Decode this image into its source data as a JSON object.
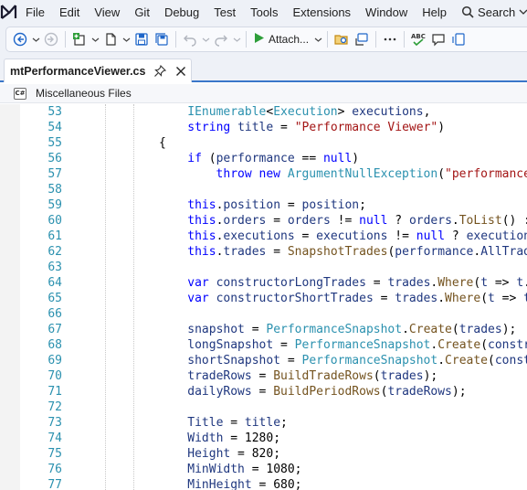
{
  "menubar": {
    "items": [
      "File",
      "Edit",
      "View",
      "Git",
      "Debug",
      "Test",
      "Tools",
      "Extensions",
      "Window",
      "Help"
    ],
    "search_label": "Search"
  },
  "toolbar": {
    "attach_label": "Attach..."
  },
  "tabs": [
    {
      "label": "mtPerformanceViewer.cs"
    }
  ],
  "navbar": {
    "icon_text": "C#",
    "scope_label": "Miscellaneous Files"
  },
  "editor": {
    "lines": [
      {
        "num": "53",
        "indent": 4,
        "tokens": [
          [
            "ty",
            "IEnumerable"
          ],
          [
            "pl",
            "<"
          ],
          [
            "ty",
            "Execution"
          ],
          [
            "pl",
            "> "
          ],
          [
            "id",
            "executions"
          ],
          [
            "pl",
            ","
          ]
        ]
      },
      {
        "num": "54",
        "indent": 4,
        "tokens": [
          [
            "kw",
            "string"
          ],
          [
            "pl",
            " "
          ],
          [
            "id",
            "title"
          ],
          [
            "pl",
            " = "
          ],
          [
            "st",
            "\"Performance Viewer\""
          ],
          [
            "pl",
            ")"
          ]
        ]
      },
      {
        "num": "55",
        "indent": 0,
        "tokens": [
          [
            "pl",
            "{"
          ]
        ]
      },
      {
        "num": "56",
        "indent": 4,
        "tokens": [
          [
            "kw",
            "if"
          ],
          [
            "pl",
            " ("
          ],
          [
            "id",
            "performance"
          ],
          [
            "pl",
            " == "
          ],
          [
            "kw",
            "null"
          ],
          [
            "pl",
            ")"
          ]
        ]
      },
      {
        "num": "57",
        "indent": 8,
        "tokens": [
          [
            "kw",
            "throw"
          ],
          [
            "pl",
            " "
          ],
          [
            "kw",
            "new"
          ],
          [
            "pl",
            " "
          ],
          [
            "ty",
            "ArgumentNullException"
          ],
          [
            "pl",
            "("
          ],
          [
            "st",
            "\"performance\""
          ]
        ]
      },
      {
        "num": "58",
        "indent": 0,
        "tokens": []
      },
      {
        "num": "59",
        "indent": 4,
        "tokens": [
          [
            "kw",
            "this"
          ],
          [
            "pl",
            "."
          ],
          [
            "id",
            "position"
          ],
          [
            "pl",
            " = "
          ],
          [
            "id",
            "position"
          ],
          [
            "pl",
            ";"
          ]
        ]
      },
      {
        "num": "60",
        "indent": 4,
        "tokens": [
          [
            "kw",
            "this"
          ],
          [
            "pl",
            "."
          ],
          [
            "id",
            "orders"
          ],
          [
            "pl",
            " = "
          ],
          [
            "id",
            "orders"
          ],
          [
            "pl",
            " != "
          ],
          [
            "kw",
            "null"
          ],
          [
            "pl",
            " ? "
          ],
          [
            "id",
            "orders"
          ],
          [
            "pl",
            "."
          ],
          [
            "mt",
            "ToList"
          ],
          [
            "pl",
            "() :"
          ]
        ]
      },
      {
        "num": "61",
        "indent": 4,
        "tokens": [
          [
            "kw",
            "this"
          ],
          [
            "pl",
            "."
          ],
          [
            "id",
            "executions"
          ],
          [
            "pl",
            " = "
          ],
          [
            "id",
            "executions"
          ],
          [
            "pl",
            " != "
          ],
          [
            "kw",
            "null"
          ],
          [
            "pl",
            " ? "
          ],
          [
            "id",
            "executions"
          ]
        ]
      },
      {
        "num": "62",
        "indent": 4,
        "tokens": [
          [
            "kw",
            "this"
          ],
          [
            "pl",
            "."
          ],
          [
            "id",
            "trades"
          ],
          [
            "pl",
            " = "
          ],
          [
            "mt",
            "SnapshotTrades"
          ],
          [
            "pl",
            "("
          ],
          [
            "id",
            "performance"
          ],
          [
            "pl",
            "."
          ],
          [
            "id",
            "AllTrades"
          ]
        ]
      },
      {
        "num": "63",
        "indent": 0,
        "tokens": []
      },
      {
        "num": "64",
        "indent": 4,
        "tokens": [
          [
            "kw",
            "var"
          ],
          [
            "pl",
            " "
          ],
          [
            "id",
            "constructorLongTrades"
          ],
          [
            "pl",
            " = "
          ],
          [
            "id",
            "trades"
          ],
          [
            "pl",
            "."
          ],
          [
            "mt",
            "Where"
          ],
          [
            "pl",
            "("
          ],
          [
            "id",
            "t"
          ],
          [
            "pl",
            " => "
          ],
          [
            "id",
            "t"
          ],
          [
            "pl",
            ".E"
          ]
        ]
      },
      {
        "num": "65",
        "indent": 4,
        "tokens": [
          [
            "kw",
            "var"
          ],
          [
            "pl",
            " "
          ],
          [
            "id",
            "constructorShortTrades"
          ],
          [
            "pl",
            " = "
          ],
          [
            "id",
            "trades"
          ],
          [
            "pl",
            "."
          ],
          [
            "mt",
            "Where"
          ],
          [
            "pl",
            "("
          ],
          [
            "id",
            "t"
          ],
          [
            "pl",
            " => "
          ],
          [
            "id",
            "t"
          ],
          [
            "pl",
            "."
          ]
        ]
      },
      {
        "num": "66",
        "indent": 0,
        "tokens": []
      },
      {
        "num": "67",
        "indent": 4,
        "tokens": [
          [
            "id",
            "snapshot"
          ],
          [
            "pl",
            " = "
          ],
          [
            "ty",
            "PerformanceSnapshot"
          ],
          [
            "pl",
            "."
          ],
          [
            "mt",
            "Create"
          ],
          [
            "pl",
            "("
          ],
          [
            "id",
            "trades"
          ],
          [
            "pl",
            ");"
          ]
        ]
      },
      {
        "num": "68",
        "indent": 4,
        "tokens": [
          [
            "id",
            "longSnapshot"
          ],
          [
            "pl",
            " = "
          ],
          [
            "ty",
            "PerformanceSnapshot"
          ],
          [
            "pl",
            "."
          ],
          [
            "mt",
            "Create"
          ],
          [
            "pl",
            "("
          ],
          [
            "id",
            "constru"
          ]
        ]
      },
      {
        "num": "69",
        "indent": 4,
        "tokens": [
          [
            "id",
            "shortSnapshot"
          ],
          [
            "pl",
            " = "
          ],
          [
            "ty",
            "PerformanceSnapshot"
          ],
          [
            "pl",
            "."
          ],
          [
            "mt",
            "Create"
          ],
          [
            "pl",
            "("
          ],
          [
            "id",
            "constr"
          ]
        ]
      },
      {
        "num": "70",
        "indent": 4,
        "tokens": [
          [
            "id",
            "tradeRows"
          ],
          [
            "pl",
            " = "
          ],
          [
            "mt",
            "BuildTradeRows"
          ],
          [
            "pl",
            "("
          ],
          [
            "id",
            "trades"
          ],
          [
            "pl",
            ");"
          ]
        ]
      },
      {
        "num": "71",
        "indent": 4,
        "tokens": [
          [
            "id",
            "dailyRows"
          ],
          [
            "pl",
            " = "
          ],
          [
            "mt",
            "BuildPeriodRows"
          ],
          [
            "pl",
            "("
          ],
          [
            "id",
            "tradeRows"
          ],
          [
            "pl",
            ");"
          ]
        ]
      },
      {
        "num": "72",
        "indent": 0,
        "tokens": []
      },
      {
        "num": "73",
        "indent": 4,
        "tokens": [
          [
            "id",
            "Title"
          ],
          [
            "pl",
            " = "
          ],
          [
            "id",
            "title"
          ],
          [
            "pl",
            ";"
          ]
        ]
      },
      {
        "num": "74",
        "indent": 4,
        "tokens": [
          [
            "id",
            "Width"
          ],
          [
            "pl",
            " = 1280;"
          ]
        ]
      },
      {
        "num": "75",
        "indent": 4,
        "tokens": [
          [
            "id",
            "Height"
          ],
          [
            "pl",
            " = 820;"
          ]
        ]
      },
      {
        "num": "76",
        "indent": 4,
        "tokens": [
          [
            "id",
            "MinWidth"
          ],
          [
            "pl",
            " = 1080;"
          ]
        ]
      },
      {
        "num": "77",
        "indent": 4,
        "tokens": [
          [
            "id",
            "MinHeight"
          ],
          [
            "pl",
            " = 680;"
          ]
        ]
      }
    ]
  }
}
